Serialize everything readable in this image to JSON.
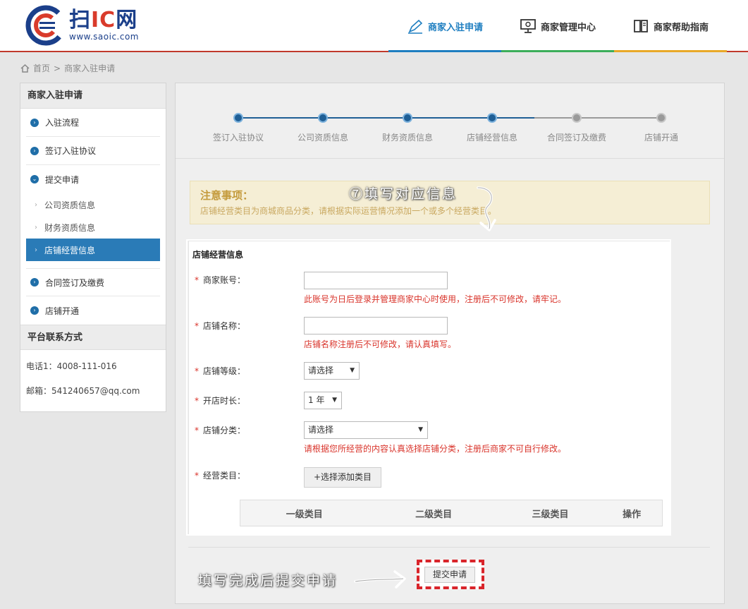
{
  "header": {
    "logo_main": "扫",
    "logo_ic": "IC",
    "logo_tail": "网",
    "logo_url": "www.saoic.com",
    "nav": [
      {
        "label": "商家入驻申请",
        "icon": "pen-icon",
        "bar_color": "#1e7ec0",
        "active": true
      },
      {
        "label": "商家管理中心",
        "icon": "monitor-icon",
        "bar_color": "#3cae5a",
        "active": false
      },
      {
        "label": "商家帮助指南",
        "icon": "book-icon",
        "bar_color": "#e9a928",
        "active": false
      }
    ]
  },
  "breadcrumb": {
    "home": "首页",
    "separator": ">",
    "current": "商家入驻申请"
  },
  "sidebar": {
    "title": "商家入驻申请",
    "items": [
      {
        "label": "入驻流程",
        "expanded": false
      },
      {
        "label": "签订入驻协议",
        "expanded": false
      },
      {
        "label": "提交申请",
        "expanded": true
      }
    ],
    "subitems": [
      {
        "label": "公司资质信息"
      },
      {
        "label": "财务资质信息"
      },
      {
        "label": "店铺经营信息"
      }
    ],
    "items2": [
      {
        "label": "合同签订及缴费"
      },
      {
        "label": "店铺开通"
      }
    ],
    "contact_title": "平台联系方式",
    "phone": "电话1：4008-111-016",
    "email": "邮箱：541240657@qq.com"
  },
  "steps": {
    "labels": [
      "签订入驻协议",
      "公司资质信息",
      "财务资质信息",
      "店铺经营信息",
      "合同签订及缴费",
      "店铺开通"
    ],
    "completed": 4,
    "active_color": "#1f5f96",
    "inactive_color": "#9a9a9a"
  },
  "notice": {
    "title": "注意事项：",
    "text": "店铺经营类目为商城商品分类，请根据实际运营情况添加一个或多个经营类目。"
  },
  "form": {
    "title": "店铺经营信息",
    "required_mark": "*",
    "account_label": "商家账号：",
    "account_hint": "此账号为日后登录并管理商家中心时使用，注册后不可修改，请牢记。",
    "shop_name_label": "店铺名称：",
    "shop_name_hint": "店铺名称注册后不可修改，请认真填写。",
    "level_label": "店铺等级：",
    "level_value": "请选择",
    "duration_label": "开店时长：",
    "duration_value": "1 年",
    "category_label": "店铺分类：",
    "category_value": "请选择",
    "category_hint": "请根据您所经营的内容认真选择店铺分类，注册后商家不可自行修改。",
    "scope_label": "经营类目：",
    "add_button": "+选择添加类目",
    "table_headers": [
      "一级类目",
      "二级类目",
      "三级类目",
      "操作"
    ]
  },
  "submit_label": "提交申请",
  "annotations": {
    "step7": "⑦填写对应信息",
    "submit": "填写完成后提交申请"
  }
}
